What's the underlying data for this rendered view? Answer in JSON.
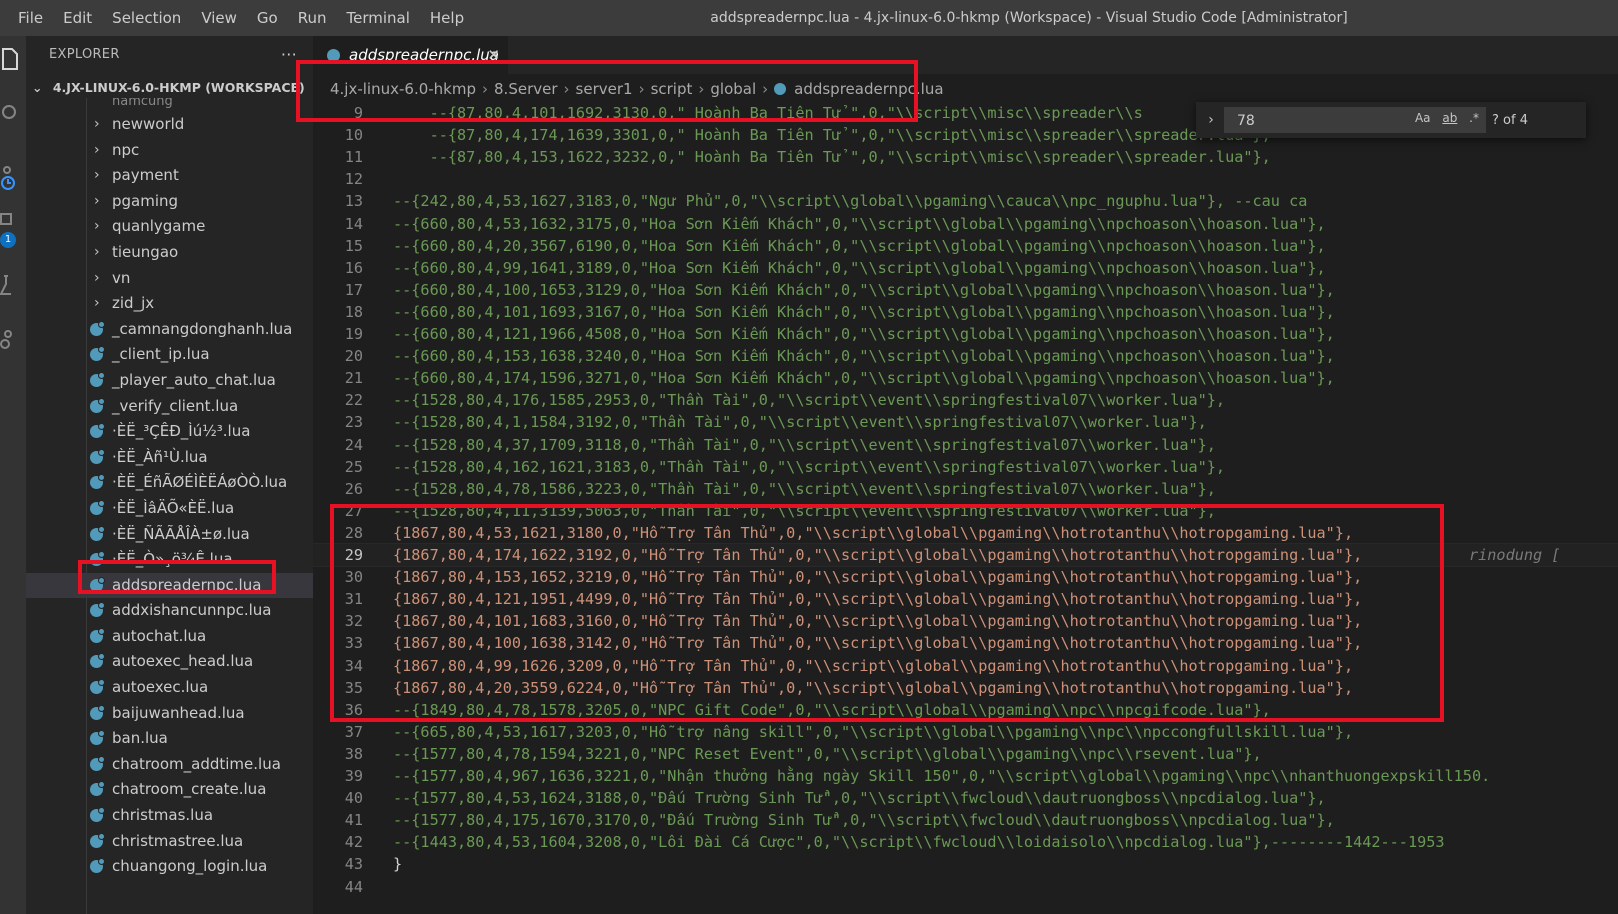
{
  "menu": [
    "File",
    "Edit",
    "Selection",
    "View",
    "Go",
    "Run",
    "Terminal",
    "Help"
  ],
  "window_title": "addspreadernpc.lua - 4.jx-linux-6.0-hkmp (Workspace) - Visual Studio Code [Administrator]",
  "activity": {
    "scm_badge": "1"
  },
  "sidebar": {
    "header": "EXPLORER",
    "more": "···",
    "workspace": "4.JX-LINUX-6.0-HKMP (WORKSPACE)",
    "partial_item": "namcung",
    "folders": [
      "newworld",
      "npc",
      "payment",
      "pgaming",
      "quanlygame",
      "tieungao",
      "vn",
      "zid_jx"
    ],
    "files": [
      "_camnangdonghanh.lua",
      "_client_ip.lua",
      "_player_auto_chat.lua",
      "_verify_client.lua",
      "·ÈË_³ÇÊÐ_Ìú½³.lua",
      "·ÈË_Àñ¹Ù.lua",
      "·ÈË_ÉñÃØÉÌÈËÁøÒÒ.lua",
      "·ÈË_ÌâÄÕ«ÈË.lua",
      "·ÈË_ÑÃÃÅÎÀ±ø.lua",
      "·ÈË_Ò»¸ö¾Ê.lua",
      "addspreadernpc.lua",
      "addxishancunnpc.lua",
      "autochat.lua",
      "autoexec_head.lua",
      "autoexec.lua",
      "baijuwanhead.lua",
      "ban.lua",
      "chatroom_addtime.lua",
      "chatroom_create.lua",
      "christmas.lua",
      "christmastree.lua",
      "chuangong_login.lua"
    ],
    "selected_file": "addspreadernpc.lua"
  },
  "tab": {
    "label": "addspreadernpc.lua",
    "close": "✕"
  },
  "breadcrumb": [
    "4.jx-linux-6.0-hkmp",
    "8.Server",
    "server1",
    "script",
    "global",
    "addspreadernpc.lua"
  ],
  "find": {
    "query": "78",
    "count": "? of 4",
    "toggle": "›",
    "opt_case": "Aa",
    "opt_word": "ab",
    "opt_regex": ".*"
  },
  "editor": {
    "blame": "rinodung [",
    "lines": [
      {
        "n": "9",
        "kind": "comment",
        "text": "    --{87,80,4,101,1692,3130,0,\" Hoành Ba Tiên Tử \",0,\"\\\\script\\\\misc\\\\spreader\\\\s"
      },
      {
        "n": "10",
        "kind": "comment",
        "text": "    --{87,80,4,174,1639,3301,0,\" Hoành Ba Tiên Tử \",0,\"\\\\script\\\\misc\\\\spreader\\\\spreader.lua\"},"
      },
      {
        "n": "11",
        "kind": "comment",
        "text": "    --{87,80,4,153,1622,3232,0,\" Hoành Ba Tiên Tử \",0,\"\\\\script\\\\misc\\\\spreader\\\\spreader.lua\"},"
      },
      {
        "n": "12",
        "kind": "comment",
        "text": ""
      },
      {
        "n": "13",
        "kind": "comment",
        "text": "--{242,80,4,53,1627,3183,0,\"Ngư Phủ\",0,\"\\\\script\\\\global\\\\pgaming\\\\cauca\\\\npc_nguphu.lua\"}, --cau ca"
      },
      {
        "n": "14",
        "kind": "comment",
        "text": "--{660,80,4,53,1632,3175,0,\"Hoa Sơn Kiếm Khách\",0,\"\\\\script\\\\global\\\\pgaming\\\\npchoason\\\\hoason.lua\"},"
      },
      {
        "n": "15",
        "kind": "comment",
        "text": "--{660,80,4,20,3567,6190,0,\"Hoa Sơn Kiếm Khách\",0,\"\\\\script\\\\global\\\\pgaming\\\\npchoason\\\\hoason.lua\"},"
      },
      {
        "n": "16",
        "kind": "comment",
        "text": "--{660,80,4,99,1641,3189,0,\"Hoa Sơn Kiếm Khách\",0,\"\\\\script\\\\global\\\\pgaming\\\\npchoason\\\\hoason.lua\"},"
      },
      {
        "n": "17",
        "kind": "comment",
        "text": "--{660,80,4,100,1653,3129,0,\"Hoa Sơn Kiếm Khách\",0,\"\\\\script\\\\global\\\\pgaming\\\\npchoason\\\\hoason.lua\"},"
      },
      {
        "n": "18",
        "kind": "comment",
        "text": "--{660,80,4,101,1693,3167,0,\"Hoa Sơn Kiếm Khách\",0,\"\\\\script\\\\global\\\\pgaming\\\\npchoason\\\\hoason.lua\"},"
      },
      {
        "n": "19",
        "kind": "comment",
        "text": "--{660,80,4,121,1966,4508,0,\"Hoa Sơn Kiếm Khách\",0,\"\\\\script\\\\global\\\\pgaming\\\\npchoason\\\\hoason.lua\"},"
      },
      {
        "n": "20",
        "kind": "comment",
        "text": "--{660,80,4,153,1638,3240,0,\"Hoa Sơn Kiếm Khách\",0,\"\\\\script\\\\global\\\\pgaming\\\\npchoason\\\\hoason.lua\"},"
      },
      {
        "n": "21",
        "kind": "comment",
        "text": "--{660,80,4,174,1596,3271,0,\"Hoa Sơn Kiếm Khách\",0,\"\\\\script\\\\global\\\\pgaming\\\\npchoason\\\\hoason.lua\"},"
      },
      {
        "n": "22",
        "kind": "comment",
        "text": "--{1528,80,4,176,1585,2953,0,\"Thần Tài\",0,\"\\\\script\\\\event\\\\springfestival07\\\\worker.lua\"},"
      },
      {
        "n": "23",
        "kind": "comment",
        "text": "--{1528,80,4,1,1584,3192,0,\"Thần Tài\",0,\"\\\\script\\\\event\\\\springfestival07\\\\worker.lua\"},"
      },
      {
        "n": "24",
        "kind": "comment",
        "text": "--{1528,80,4,37,1709,3118,0,\"Thần Tài\",0,\"\\\\script\\\\event\\\\springfestival07\\\\worker.lua\"},"
      },
      {
        "n": "25",
        "kind": "comment",
        "text": "--{1528,80,4,162,1621,3183,0,\"Thần Tài\",0,\"\\\\script\\\\event\\\\springfestival07\\\\worker.lua\"},"
      },
      {
        "n": "26",
        "kind": "comment",
        "text": "--{1528,80,4,78,1586,3223,0,\"Thần Tài\",0,\"\\\\script\\\\event\\\\springfestival07\\\\worker.lua\"},"
      },
      {
        "n": "27",
        "kind": "comment",
        "text": "--{1528,80,4,11,3139,5063,0,\"Thần Tài\",0,\"\\\\script\\\\event\\\\springfestival07\\\\worker.lua\"},"
      },
      {
        "n": "28",
        "kind": "code",
        "text": "{1867,80,4,53,1621,3180,0,\"Hỗ Trợ Tân Thủ\",0,\"\\\\script\\\\global\\\\pgaming\\\\hotrotanthu\\\\hotropgaming.lua\"},"
      },
      {
        "n": "29",
        "kind": "code",
        "text": "{1867,80,4,174,1622,3192,0,\"Hỗ Trợ Tân Thủ\",0,\"\\\\script\\\\global\\\\pgaming\\\\hotrotanthu\\\\hotropgaming.lua\"},"
      },
      {
        "n": "30",
        "kind": "code",
        "text": "{1867,80,4,153,1652,3219,0,\"Hỗ Trợ Tân Thủ\",0,\"\\\\script\\\\global\\\\pgaming\\\\hotrotanthu\\\\hotropgaming.lua\"},"
      },
      {
        "n": "31",
        "kind": "code",
        "text": "{1867,80,4,121,1951,4499,0,\"Hỗ Trợ Tân Thủ\",0,\"\\\\script\\\\global\\\\pgaming\\\\hotrotanthu\\\\hotropgaming.lua\"},"
      },
      {
        "n": "32",
        "kind": "code",
        "text": "{1867,80,4,101,1683,3160,0,\"Hỗ Trợ Tân Thủ\",0,\"\\\\script\\\\global\\\\pgaming\\\\hotrotanthu\\\\hotropgaming.lua\"},"
      },
      {
        "n": "33",
        "kind": "code",
        "text": "{1867,80,4,100,1638,3142,0,\"Hỗ Trợ Tân Thủ\",0,\"\\\\script\\\\global\\\\pgaming\\\\hotrotanthu\\\\hotropgaming.lua\"},"
      },
      {
        "n": "34",
        "kind": "code",
        "text": "{1867,80,4,99,1626,3209,0,\"Hỗ Trợ Tân Thủ\",0,\"\\\\script\\\\global\\\\pgaming\\\\hotrotanthu\\\\hotropgaming.lua\"},"
      },
      {
        "n": "35",
        "kind": "code",
        "text": "{1867,80,4,20,3559,6224,0,\"Hỗ Trợ Tân Thủ\",0,\"\\\\script\\\\global\\\\pgaming\\\\hotrotanthu\\\\hotropgaming.lua\"},"
      },
      {
        "n": "36",
        "kind": "comment",
        "text": "--{1849,80,4,78,1578,3205,0,\"NPC Gift Code\",0,\"\\\\script\\\\global\\\\pgaming\\\\npc\\\\npcgifcode.lua\"},"
      },
      {
        "n": "37",
        "kind": "comment",
        "text": "--{665,80,4,53,1617,3203,0,\"Hỗ trợ nâng skill\",0,\"\\\\script\\\\global\\\\pgaming\\\\npc\\\\npccongfullskill.lua\"},"
      },
      {
        "n": "38",
        "kind": "comment",
        "text": "--{1577,80,4,78,1594,3221,0,\"NPC Reset Event\",0,\"\\\\script\\\\global\\\\pgaming\\\\npc\\\\rsevent.lua\"},"
      },
      {
        "n": "39",
        "kind": "comment",
        "text": "--{1577,80,4,967,1636,3221,0,\"Nhận thưởng hằng ngày Skill 150\",0,\"\\\\script\\\\global\\\\pgaming\\\\npc\\\\nhanthuongexpskill150."
      },
      {
        "n": "40",
        "kind": "comment",
        "text": "--{1577,80,4,53,1624,3188,0,\"Đấu Trường Sinh Tử\",0,\"\\\\script\\\\fwcloud\\\\dautruongboss\\\\npcdialog.lua\"},"
      },
      {
        "n": "41",
        "kind": "comment",
        "text": "--{1577,80,4,175,1670,3170,0,\"Đấu Trường Sinh Tử\",0,\"\\\\script\\\\fwcloud\\\\dautruongboss\\\\npcdialog.lua\"},"
      },
      {
        "n": "42",
        "kind": "comment",
        "text": "--{1443,80,4,53,1604,3208,0,\"Lôi Đài Cá Cược\",0,\"\\\\script\\\\fwcloud\\\\loidaisolo\\\\npcdialog.lua\"},--------1442---1953"
      },
      {
        "n": "43",
        "kind": "brace",
        "text": "}"
      },
      {
        "n": "44",
        "kind": "comment",
        "text": ""
      }
    ],
    "current_line": "29"
  }
}
